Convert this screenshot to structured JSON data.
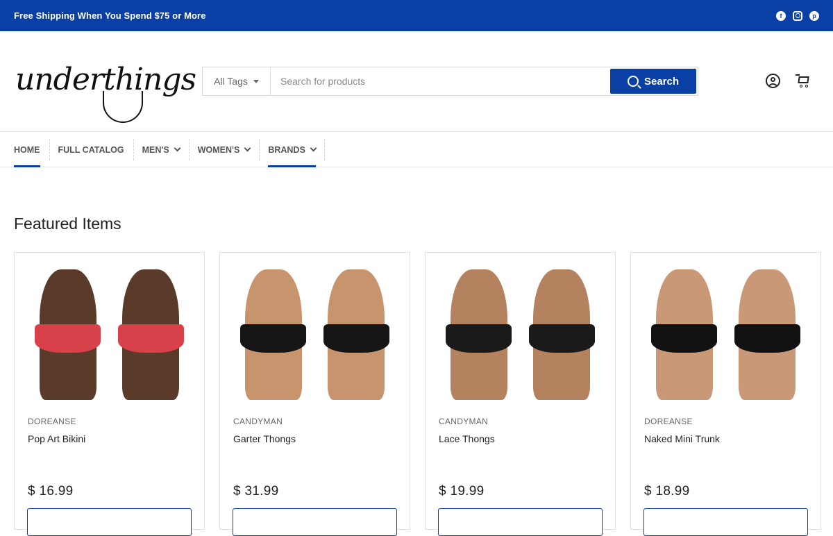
{
  "promo": {
    "text": "Free Shipping When You Spend $75 or More",
    "social_icons": [
      "facebook-icon",
      "instagram-icon",
      "pinterest-icon"
    ]
  },
  "header": {
    "logo_text": "underthings",
    "tags_select": "All Tags",
    "search_placeholder": "Search for products",
    "search_button": "Search"
  },
  "nav": {
    "items": [
      {
        "label": "HOME",
        "active": true,
        "dropdown": false
      },
      {
        "label": "FULL CATALOG",
        "active": false,
        "dropdown": false
      },
      {
        "label": "MEN'S",
        "active": false,
        "dropdown": true
      },
      {
        "label": "WOMEN'S",
        "active": false,
        "dropdown": true
      },
      {
        "label": "BRANDS",
        "active": true,
        "dropdown": true
      }
    ]
  },
  "featured": {
    "title": "Featured Items",
    "products": [
      {
        "brand": "DOREANSE",
        "name": "Pop Art Bikini",
        "price": "$ 16.99",
        "skin": "#5a3a28",
        "garment": "#d8404a"
      },
      {
        "brand": "CANDYMAN",
        "name": "Garter Thongs",
        "price": "$ 31.99",
        "skin": "#c8946e",
        "garment": "#151515"
      },
      {
        "brand": "CANDYMAN",
        "name": "Lace Thongs",
        "price": "$ 19.99",
        "skin": "#b58260",
        "garment": "#1a1a1a"
      },
      {
        "brand": "DOREANSE",
        "name": "Naked Mini Trunk",
        "price": "$ 18.99",
        "skin": "#c89877",
        "garment": "#111111"
      }
    ]
  },
  "colors": {
    "brand_blue": "#0a3fa6"
  }
}
